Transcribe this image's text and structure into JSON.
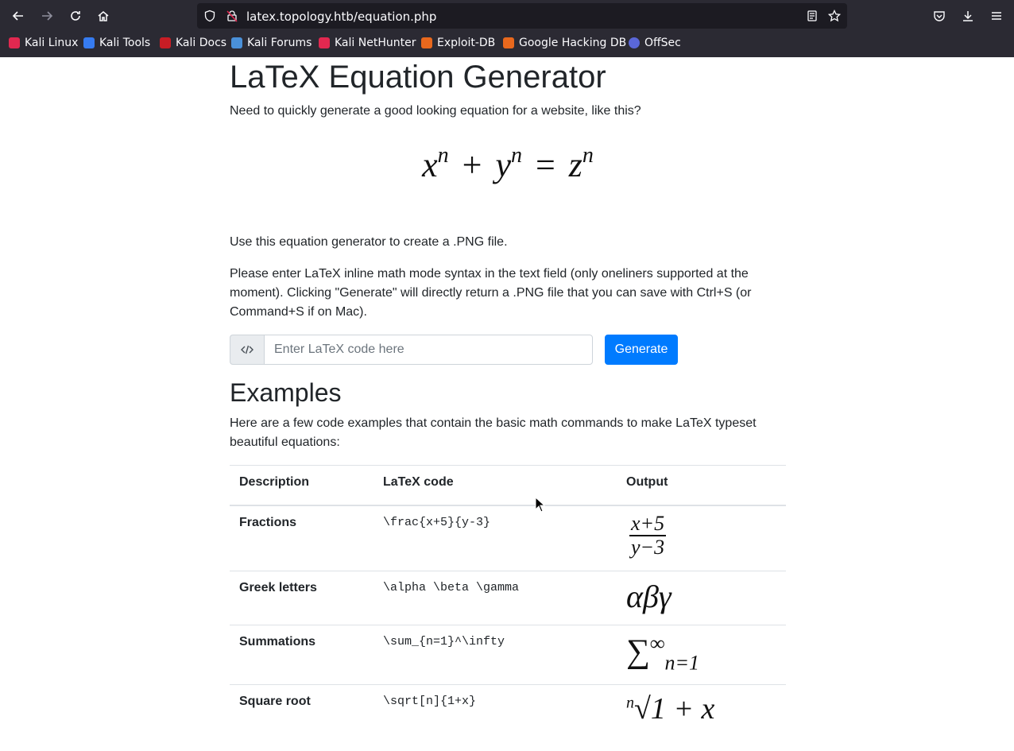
{
  "browser": {
    "url": "latex.topology.htb/equation.php",
    "bookmarks": [
      "Kali Linux",
      "Kali Tools",
      "Kali Docs",
      "Kali Forums",
      "Kali NetHunter",
      "Exploit-DB",
      "Google Hacking DB",
      "OffSec"
    ]
  },
  "page": {
    "title": "LaTeX Equation Generator",
    "intro": "Need to quickly generate a good looking equation for a website, like this?",
    "hero_equation": {
      "x": "x",
      "y": "y",
      "z": "z",
      "exp": "n",
      "plus": "+",
      "equals": "="
    },
    "use_text": "Use this equation generator to create a .PNG file.",
    "instructions": "Please enter LaTeX inline math mode syntax in the text field (only oneliners supported at the moment). Clicking \"Generate\" will directly return a .PNG file that you can save with Ctrl+S (or Command+S if on Mac).",
    "input_placeholder": "Enter LaTeX code here",
    "generate_label": "Generate",
    "examples_heading": "Examples",
    "examples_intro": "Here are a few code examples that contain the basic math commands to make LaTeX typeset beautiful equations:",
    "table": {
      "headers": [
        "Description",
        "LaTeX code",
        "Output"
      ],
      "rows": [
        {
          "desc": "Fractions",
          "code": "\\frac{x+5}{y-3}",
          "out_num": "x+5",
          "out_den": "y−3"
        },
        {
          "desc": "Greek letters",
          "code": "\\alpha \\beta \\gamma",
          "out": "αβγ"
        },
        {
          "desc": "Summations",
          "code": "\\sum_{n=1}^\\infty",
          "out_sym": "∑",
          "out_sup": "∞",
          "out_sub": "n=1"
        },
        {
          "desc": "Square root",
          "code": "\\sqrt[n]{1+x}",
          "out_idx": "n",
          "out": "√1 + x"
        }
      ]
    }
  }
}
